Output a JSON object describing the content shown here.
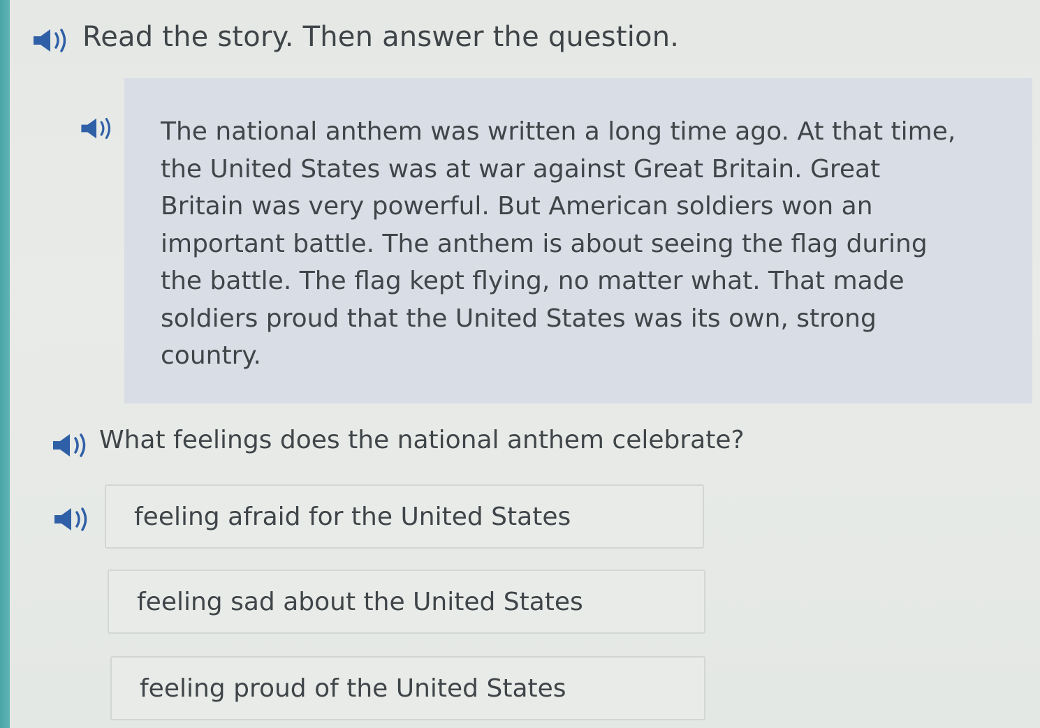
{
  "instruction": {
    "text": "Read the story. Then answer the question.",
    "audio_icon": "speaker-icon"
  },
  "passage": {
    "audio_icon": "speaker-icon",
    "lines": [
      "The national anthem was written a long time ago. At that time,",
      "the United States was at war against Great Britain. Great",
      "Britain was very powerful. But American soldiers won an",
      "important battle. The anthem is about seeing the flag during",
      "the battle. The flag kept flying, no matter what. That made",
      "soldiers proud that the United States was its own, strong",
      "country."
    ]
  },
  "question": {
    "text": "What feelings does the national anthem celebrate?",
    "audio_icon": "speaker-icon"
  },
  "choices": [
    {
      "label": "feeling afraid for the United States",
      "audio_icon": "speaker-icon"
    },
    {
      "label": "feeling sad about the United States"
    },
    {
      "label": "feeling proud of the United States"
    }
  ],
  "colors": {
    "accent_strip": "#4aa6a8",
    "passage_background": "#d8dde6",
    "speaker_icon": "#2f5fa6",
    "text": "#3f4548"
  }
}
